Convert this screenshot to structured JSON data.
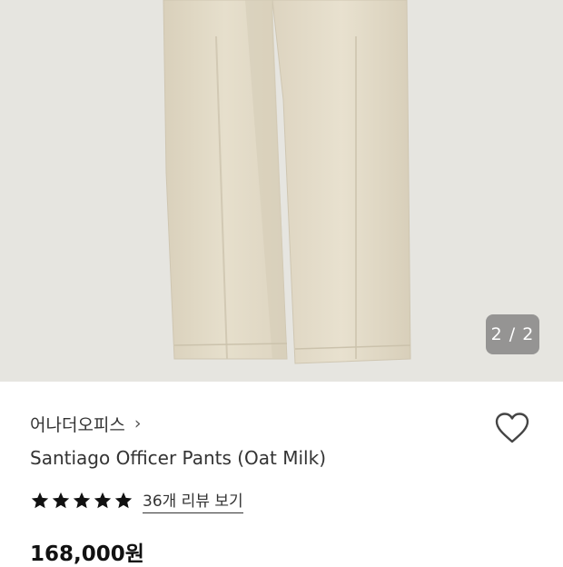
{
  "gallery": {
    "page_indicator": "2 / 2"
  },
  "product": {
    "brand": "어나더오피스",
    "brand_chevron": "›",
    "title": "Santiago Officer Pants (Oat Milk)",
    "rating": 5,
    "review_link": "36개 리뷰 보기",
    "price": "168,000원"
  },
  "icons": {
    "wishlist": "heart-outline-icon",
    "star": "star-filled-icon"
  },
  "colors": {
    "star": "#111111",
    "pants": "#e2dac6",
    "background": "#e6e5e0"
  }
}
